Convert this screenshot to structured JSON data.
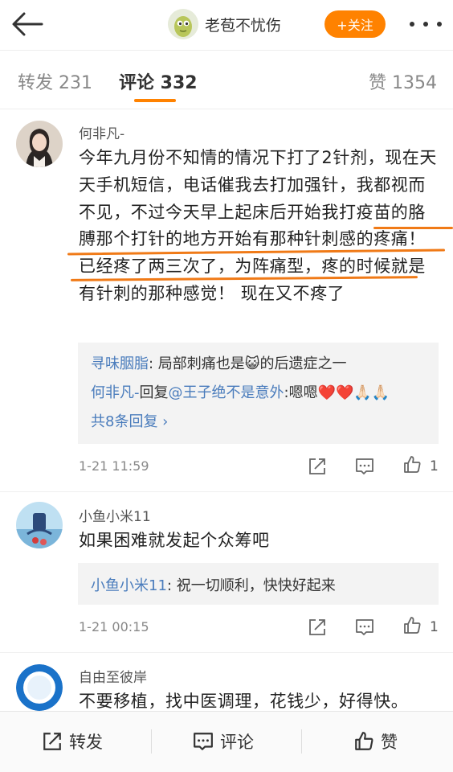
{
  "header": {
    "account_name": "老苞不忧伤",
    "follow_label": "+关注"
  },
  "tabs": [
    {
      "label": "转发 231"
    },
    {
      "label": "评论 332"
    },
    {
      "label": "赞 1354"
    }
  ],
  "comments": [
    {
      "username": "何非凡-",
      "text": "今年九月份不知情的情况下打了2针剂，现在天天手机短信，电话催我去打加强针，我都视而不见，不过今天早上起床后开始我打疫苗的胳膊那个打针的地方开始有那种针刺感的疼痛！已经疼了两三次了，为阵痛型，疼的时候就是有针刺的那种感觉！ 现在又不疼了",
      "replies": [
        {
          "user": "寻味胭脂",
          "text": ": 局部刺痛也是😺的后遗症之一"
        },
        {
          "user": "何非凡-",
          "mid": "回复",
          "target": "@王子绝不是意外",
          "text": ":嗯嗯❤️❤️🙏🏻🙏🏻"
        }
      ],
      "more_replies": "共8条回复 ›",
      "time": "1-21 11:59",
      "likes": "1"
    },
    {
      "username": "小鱼小米11",
      "text": "如果困难就发起个众筹吧",
      "replies": [
        {
          "user": "小鱼小米11",
          "text": ": 祝一切顺利，快快好起来"
        }
      ],
      "time": "1-21 00:15",
      "likes": "1"
    },
    {
      "username": "自由至彼岸",
      "text": "不要移植，找中医调理，花钱少，好得快。"
    }
  ],
  "bottom_bar": {
    "repost": "转发",
    "comment": "评论",
    "like": "赞"
  },
  "colors": {
    "accent": "#ff8200",
    "link": "#4a7cbc"
  }
}
